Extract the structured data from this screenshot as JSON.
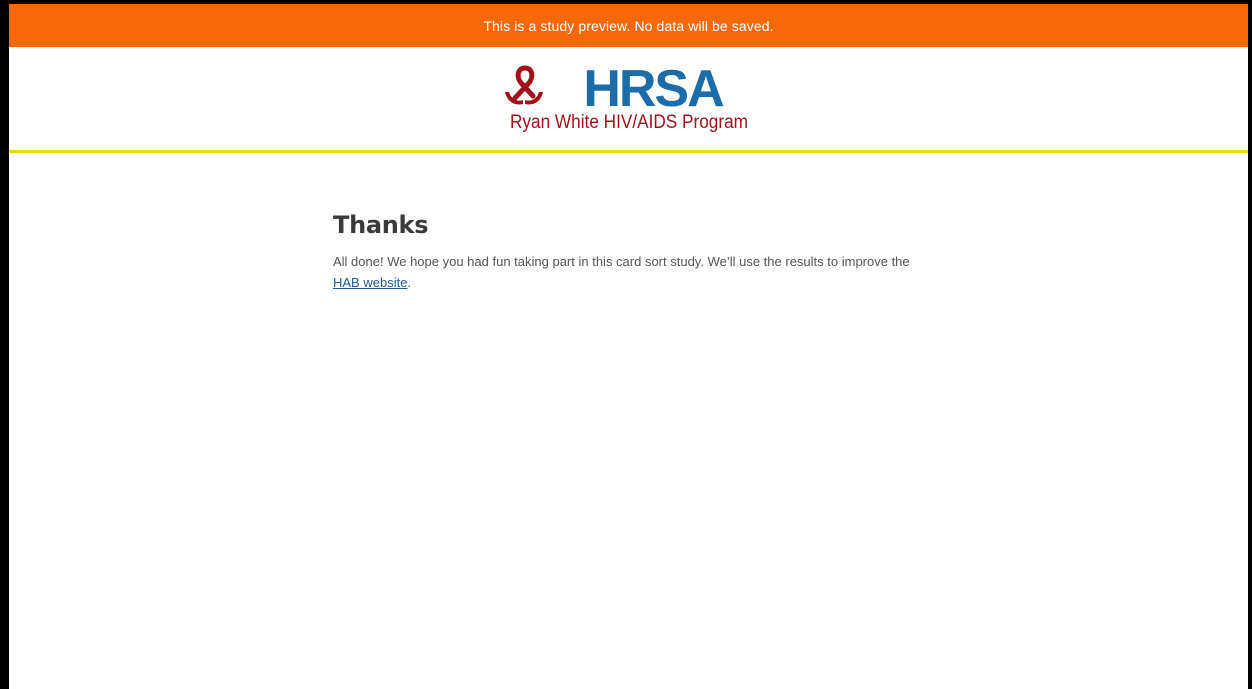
{
  "banner": {
    "text": "This is a study preview. No data will be saved."
  },
  "header": {
    "logo": {
      "wordmark": "HRSA",
      "subtitle": "Ryan White HIV/AIDS Program",
      "ribbon_icon": "red-ribbon-with-hands-icon"
    }
  },
  "main": {
    "title": "Thanks",
    "message_before_link": "All done! We hope you had fun taking part in this card sort study. We’ll use the results to improve the ",
    "link_text": "HAB website",
    "message_after_link": "."
  },
  "colors": {
    "banner_bg": "#f76808",
    "header_rule": "#f2d31a",
    "logo_blue": "#1b6ca8",
    "logo_red": "#a1131b",
    "link": "#1f5a96"
  }
}
